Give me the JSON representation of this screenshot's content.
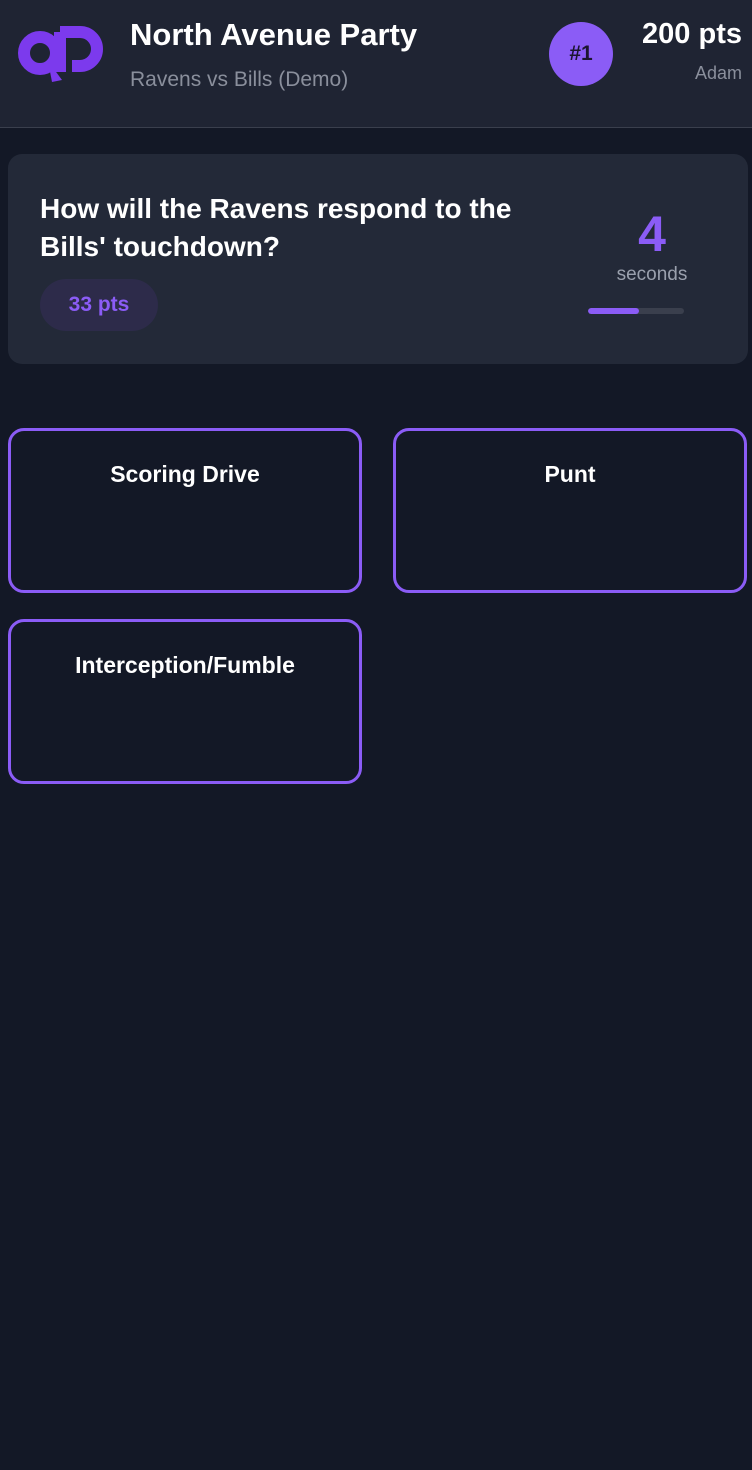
{
  "header": {
    "logo_icon": "qp-logo-icon",
    "title": "North Avenue Party",
    "subtitle": "Ravens vs Bills (Demo)",
    "rank": "#1",
    "score": "200 pts",
    "username": "Adam"
  },
  "question": {
    "text": "How will the Ravens respond to the Bills' touchdown?",
    "points": "33 pts"
  },
  "timer": {
    "value": "4",
    "label": "seconds",
    "remaining_fraction": 0.53
  },
  "options": [
    {
      "label": "Scoring Drive"
    },
    {
      "label": "Punt"
    },
    {
      "label": "Interception/Fumble"
    }
  ],
  "colors": {
    "accent": "#8b5cf6",
    "background": "#131826",
    "header_bg": "#1f2433",
    "card_bg": "#232938",
    "muted_text": "#8a8f9c"
  }
}
